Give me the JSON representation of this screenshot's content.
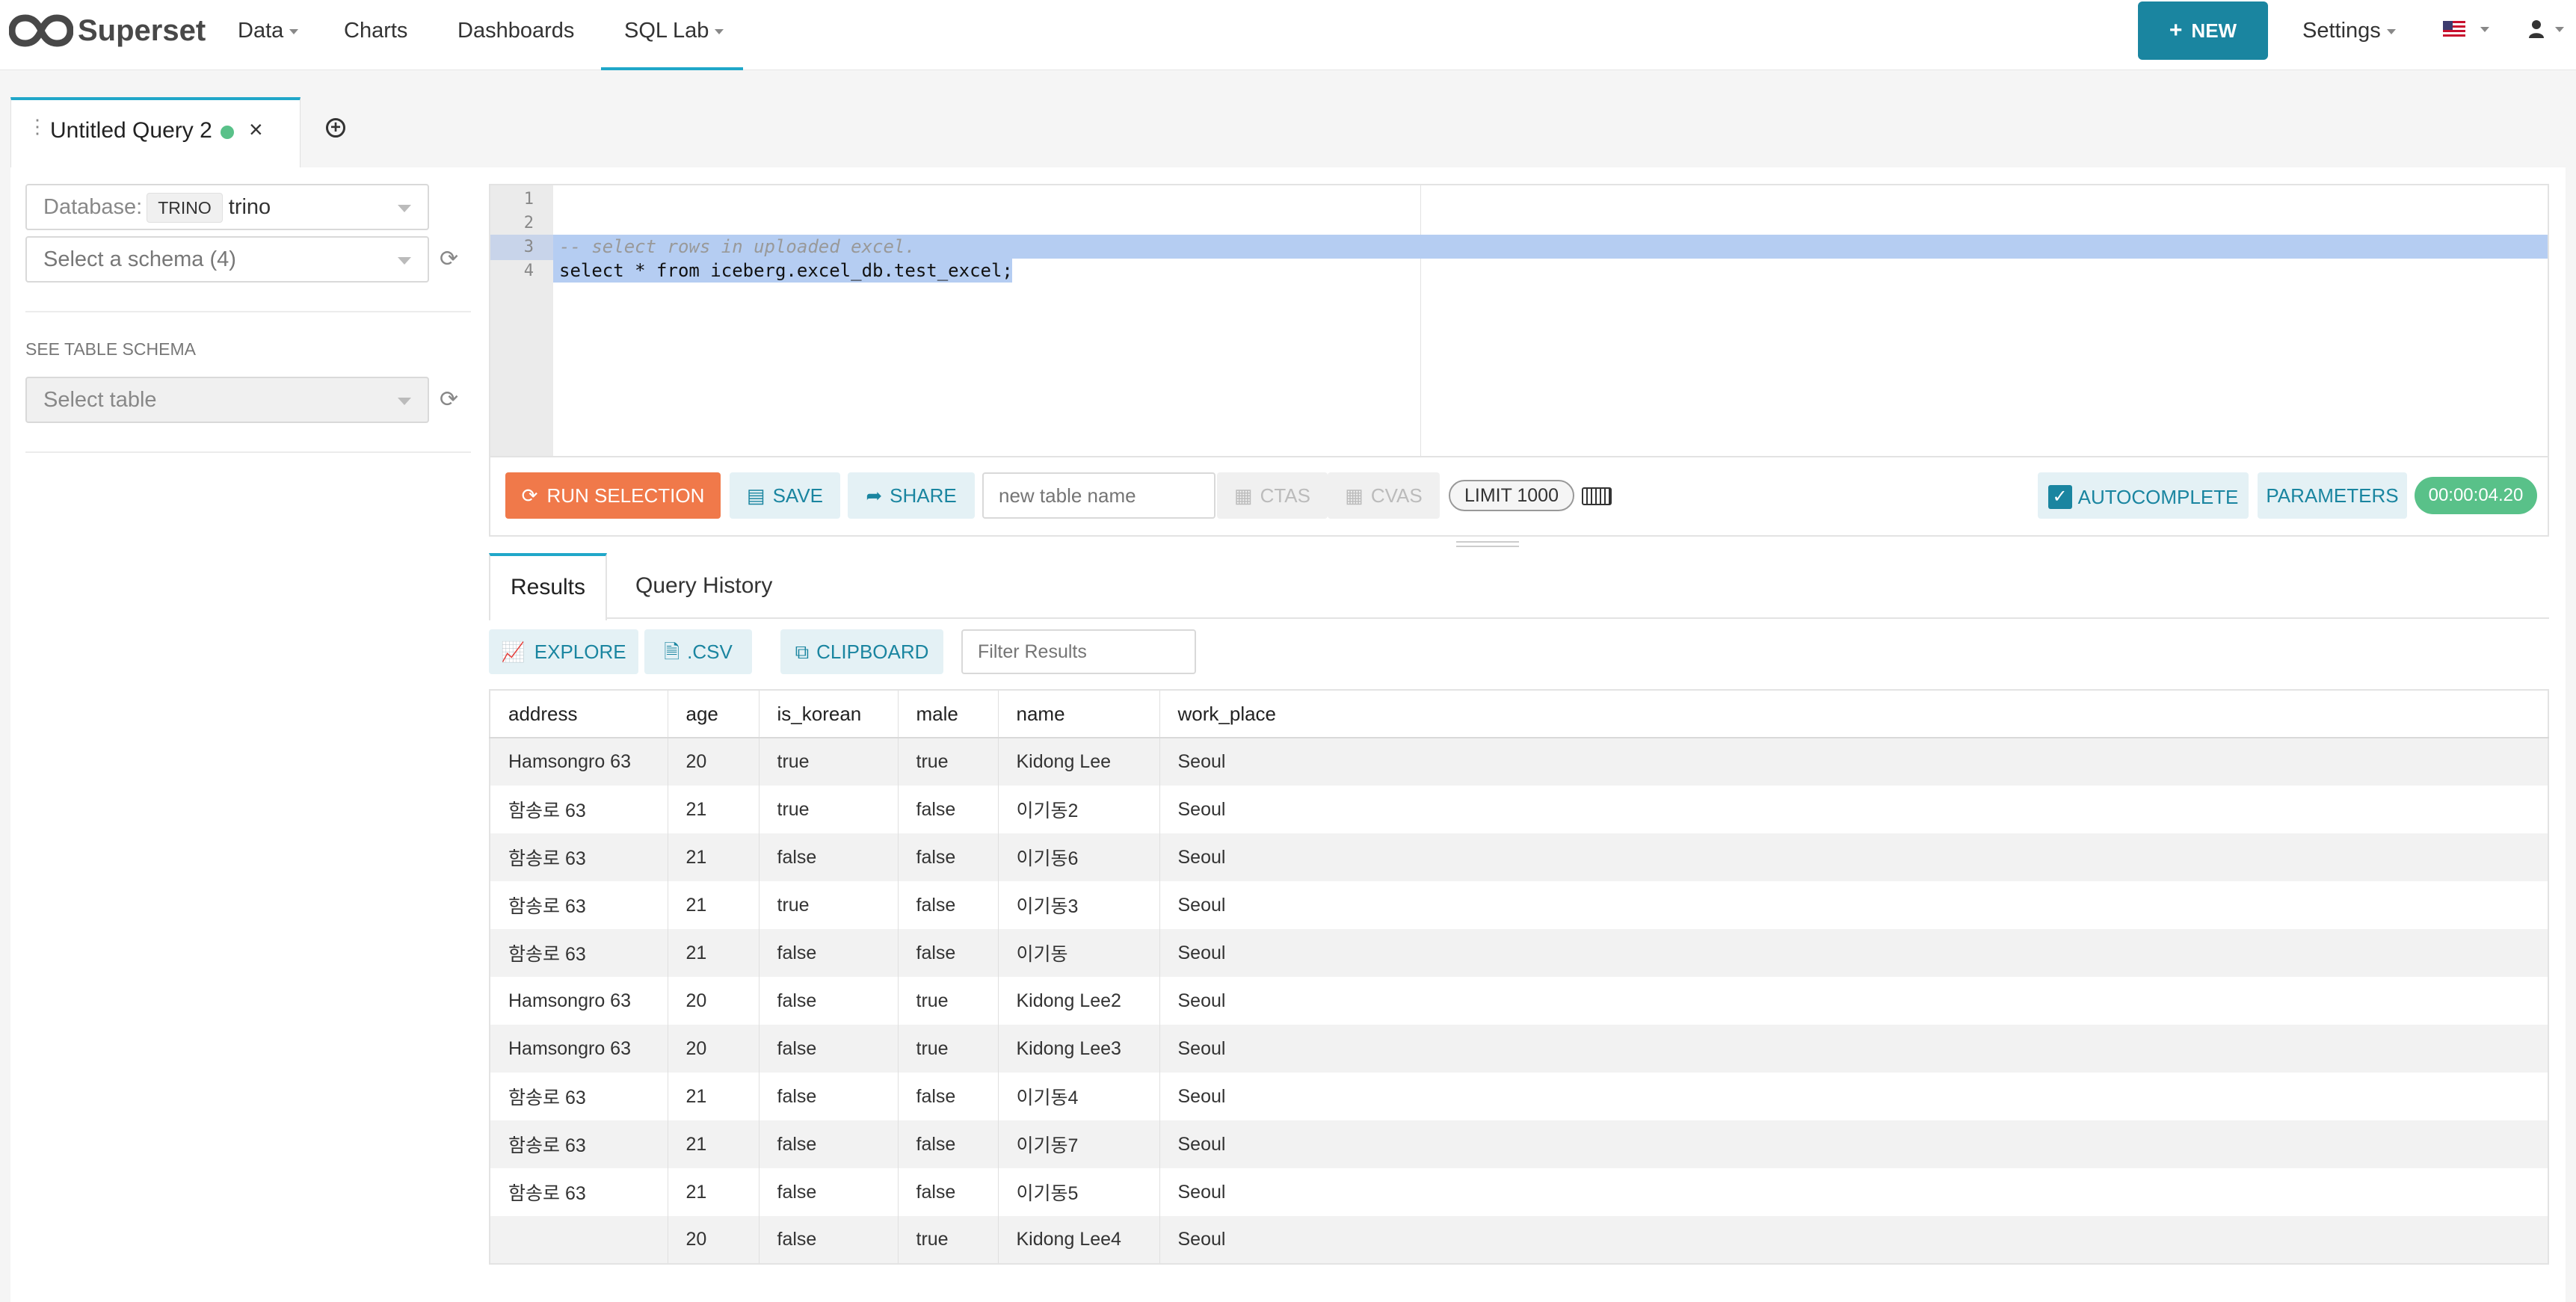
{
  "nav": {
    "brand": "Superset",
    "items": [
      {
        "label": "Data",
        "dropdown": true
      },
      {
        "label": "Charts",
        "dropdown": false
      },
      {
        "label": "Dashboards",
        "dropdown": false
      },
      {
        "label": "SQL Lab",
        "dropdown": true
      }
    ],
    "new_label": "NEW",
    "settings_label": "Settings"
  },
  "tabs": {
    "query_tab_title": "Untitled Query 2"
  },
  "sidebar": {
    "database_label": "Database:",
    "database_tag": "TRINO",
    "database_value": "trino",
    "schema_placeholder": "Select a schema (4)",
    "see_table_schema": "SEE TABLE SCHEMA",
    "table_placeholder": "Select table"
  },
  "editor": {
    "line_numbers": [
      "1",
      "2",
      "3",
      "4"
    ],
    "lines": [
      "",
      "",
      "-- select rows in uploaded excel.",
      "select * from iceberg.excel_db.test_excel;"
    ]
  },
  "toolbar": {
    "run_label": "RUN SELECTION",
    "save_label": "SAVE",
    "share_label": "SHARE",
    "table_name_placeholder": "new table name",
    "ctas_label": "CTAS",
    "cvas_label": "CVAS",
    "limit_label": "LIMIT 1000",
    "autocomplete_label": "AUTOCOMPLETE",
    "parameters_label": "PARAMETERS",
    "timer": "00:00:04.20"
  },
  "results": {
    "tab_results": "Results",
    "tab_history": "Query History",
    "explore_label": "EXPLORE",
    "csv_label": ".CSV",
    "clipboard_label": "CLIPBOARD",
    "filter_placeholder": "Filter Results",
    "columns": [
      "address",
      "age",
      "is_korean",
      "male",
      "name",
      "work_place"
    ],
    "rows": [
      [
        "Hamsongro 63",
        "20",
        "true",
        "true",
        "Kidong Lee",
        "Seoul"
      ],
      [
        "함송로 63",
        "21",
        "true",
        "false",
        "이기동2",
        "Seoul"
      ],
      [
        "함송로 63",
        "21",
        "false",
        "false",
        "이기동6",
        "Seoul"
      ],
      [
        "함송로 63",
        "21",
        "true",
        "false",
        "이기동3",
        "Seoul"
      ],
      [
        "함송로 63",
        "21",
        "false",
        "false",
        "이기동",
        "Seoul"
      ],
      [
        "Hamsongro 63",
        "20",
        "false",
        "true",
        "Kidong Lee2",
        "Seoul"
      ],
      [
        "Hamsongro 63",
        "20",
        "false",
        "true",
        "Kidong Lee3",
        "Seoul"
      ],
      [
        "함송로 63",
        "21",
        "false",
        "false",
        "이기동4",
        "Seoul"
      ],
      [
        "함송로 63",
        "21",
        "false",
        "false",
        "이기동7",
        "Seoul"
      ],
      [
        "함송로 63",
        "21",
        "false",
        "false",
        "이기동5",
        "Seoul"
      ],
      [
        "",
        "20",
        "false",
        "true",
        "Kidong Lee4",
        "Seoul"
      ]
    ]
  },
  "colors": {
    "accent": "#20a7c9",
    "run_button": "#f0794a",
    "new_button": "#1a85a0",
    "status_dot": "#59c189",
    "timer_bg": "#59c189"
  }
}
